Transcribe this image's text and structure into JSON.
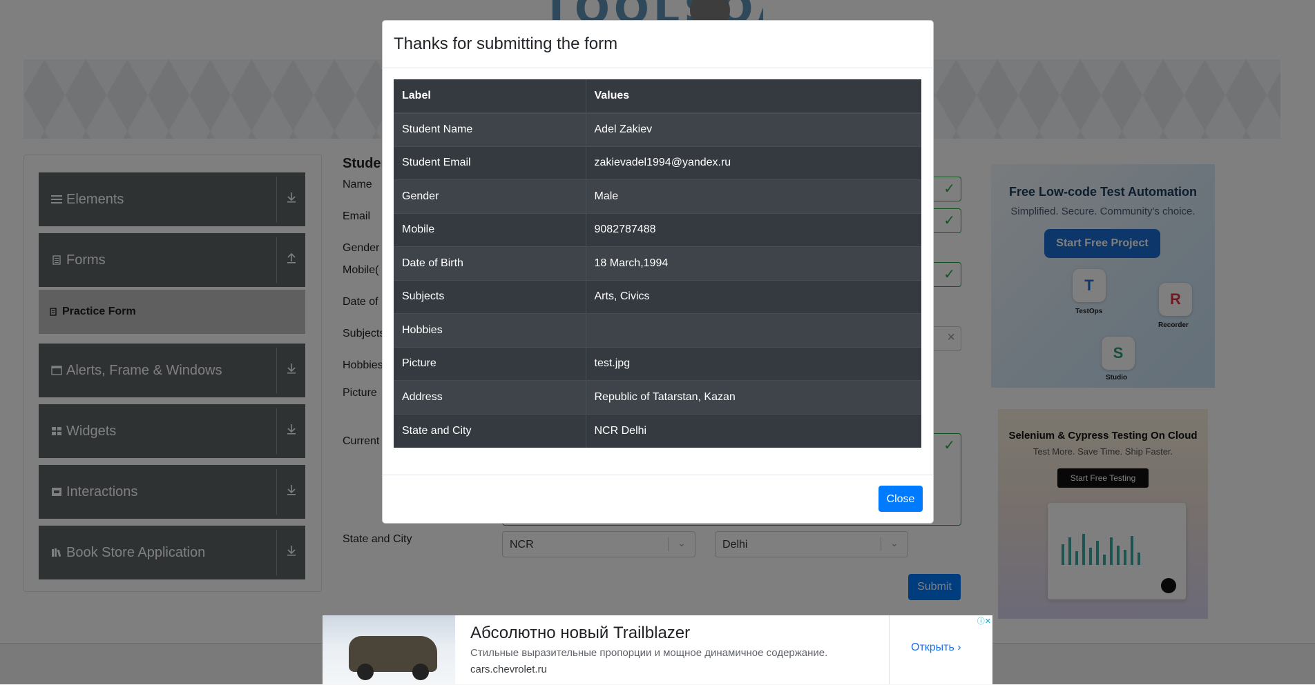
{
  "header": {
    "logo_text": "TOOLSQA"
  },
  "sidebar": {
    "groups": [
      {
        "label": "Elements",
        "icon": "hamburger-icon"
      },
      {
        "label": "Forms",
        "icon": "document-icon"
      },
      {
        "label": "Alerts, Frame & Windows",
        "icon": "window-icon"
      },
      {
        "label": "Widgets",
        "icon": "widgets-icon"
      },
      {
        "label": "Interactions",
        "icon": "interactions-icon"
      },
      {
        "label": "Book Store Application",
        "icon": "books-icon"
      }
    ],
    "active_item": "Practice Form"
  },
  "form": {
    "heading": "Studen",
    "labels": {
      "name": "Name",
      "email": "Email",
      "gender": "Gender",
      "mobile": "Mobile(",
      "dob": "Date of",
      "subjects": "Subjects",
      "hobbies": "Hobbies",
      "picture": "Picture",
      "current": "Current",
      "state_city": "State and City"
    },
    "state_value": "NCR",
    "city_value": "Delhi",
    "submit_label": "Submit"
  },
  "ads": {
    "right1": {
      "title": "Free Low-code Test Automation",
      "subtitle": "Simplified. Secure. Community's choice.",
      "button": "Start Free Project",
      "tile_testops": "TestOps",
      "tile_recorder": "Recorder",
      "tile_studio": "Studio"
    },
    "right2": {
      "title": "Selenium & Cypress Testing On Cloud",
      "subtitle": "Test More. Save Time. Ship Faster.",
      "button": "Start Free Testing"
    },
    "bottom": {
      "title": "Абсолютно новый Trailblazer",
      "description": "Стильные выразительные пропорции и мощное динамичное содержание.",
      "domain": "cars.chevrolet.ru",
      "cta": "Открыть"
    }
  },
  "modal": {
    "title": "Thanks for submitting the form",
    "table_headers": [
      "Label",
      "Values"
    ],
    "rows": [
      {
        "label": "Student Name",
        "value": "Adel Zakiev"
      },
      {
        "label": "Student Email",
        "value": "zakievadel1994@yandex.ru"
      },
      {
        "label": "Gender",
        "value": "Male"
      },
      {
        "label": "Mobile",
        "value": "9082787488"
      },
      {
        "label": "Date of Birth",
        "value": "18 March,1994"
      },
      {
        "label": "Subjects",
        "value": "Arts, Civics"
      },
      {
        "label": "Hobbies",
        "value": ""
      },
      {
        "label": "Picture",
        "value": "test.jpg"
      },
      {
        "label": "Address",
        "value": "Republic of Tatarstan, Kazan"
      },
      {
        "label": "State and City",
        "value": "NCR Delhi"
      }
    ],
    "close_label": "Close"
  },
  "colors": {
    "primary": "#007bff",
    "dark_table": "#343a40",
    "sidebar_header": "#5f6466",
    "valid_green": "#28a745"
  }
}
